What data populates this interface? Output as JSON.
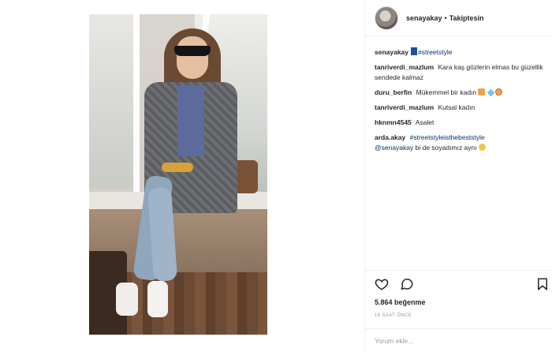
{
  "post": {
    "username": "senayakay",
    "separator": "•",
    "follow_status": "Takiptesin",
    "caption": {
      "user": "senayakay",
      "flag_icon": "flag-icon",
      "hashtag": "#streetstyle"
    },
    "comments": [
      {
        "user": "tanriverdi_mazlum",
        "text": "Kara kaş gözlerin elmas bu güzellik sendede kalmaz"
      },
      {
        "user": "duru_berfin",
        "text": "Mükemmel bir kadın"
      },
      {
        "user": "tanriverdi_mazlum",
        "text": "Kutsal kadın"
      },
      {
        "user": "hknmn4545",
        "text": "Asalet"
      },
      {
        "user": "arda.akay",
        "hashtag": "#streetstyleisthebeststyle",
        "mention": "@senayakay",
        "text": "bi de soyadımız aynı"
      }
    ],
    "likes": "5.864 beğenme",
    "time": "16 SAAT ÖNCE",
    "add_comment_placeholder": "Yorum ekle...",
    "colors": {
      "link": "#003569",
      "text": "#262626",
      "muted": "#999999",
      "divider": "#efefef"
    }
  }
}
